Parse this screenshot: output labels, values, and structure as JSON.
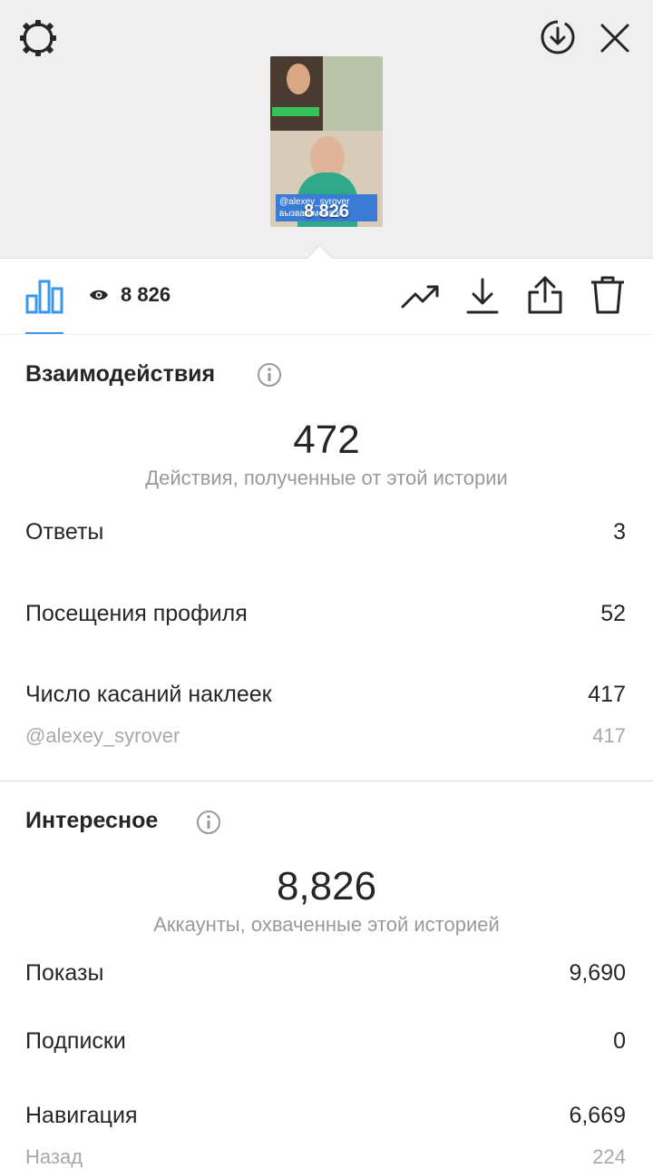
{
  "story": {
    "view_count_overlay": "8 826",
    "caption": "@alexey_syrover вызвал меня в эстафету"
  },
  "toolbar": {
    "view_count": "8 826",
    "accent_color": "#3897f0"
  },
  "interactions": {
    "title": "Взаимодействия",
    "total": "472",
    "total_caption": "Действия, полученные от этой истории",
    "rows": [
      {
        "label": "Ответы",
        "value": "3"
      },
      {
        "label": "Посещения профиля",
        "value": "52"
      },
      {
        "label": "Число касаний наклеек",
        "value": "417"
      }
    ],
    "sticker": {
      "label": "@alexey_syrover",
      "value": "417"
    }
  },
  "discovery": {
    "title": "Интересное",
    "total": "8,826",
    "total_caption": "Аккаунты, охваченные этой историей",
    "rows": [
      {
        "label": "Показы",
        "value": "9,690"
      },
      {
        "label": "Подписки",
        "value": "0"
      },
      {
        "label": "Навигация",
        "value": "6,669"
      }
    ],
    "sub_row": {
      "label": "Назад",
      "value": "224"
    }
  },
  "icons": {
    "settings": "gear-icon",
    "save": "download-circle-icon",
    "close": "close-icon",
    "insights": "bar-chart-icon",
    "views": "eye-icon",
    "promote": "trend-up-icon",
    "download": "download-icon",
    "share": "share-icon",
    "delete": "trash-icon"
  }
}
